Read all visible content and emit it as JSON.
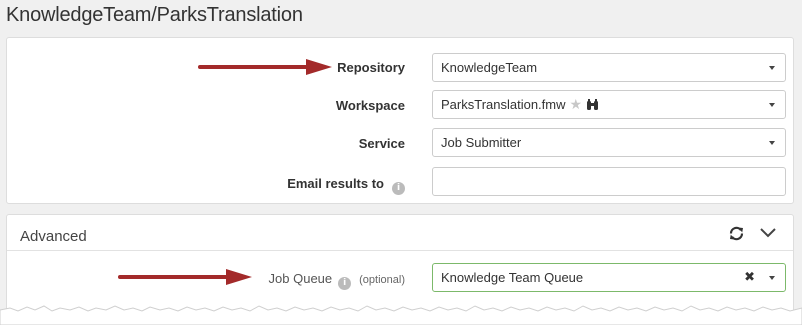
{
  "page": {
    "title": "KnowledgeTeam/ParksTranslation"
  },
  "form": {
    "repository": {
      "label": "Repository",
      "value": "KnowledgeTeam"
    },
    "workspace": {
      "label": "Workspace",
      "value": "ParksTranslation.fmw"
    },
    "service": {
      "label": "Service",
      "value": "Job Submitter"
    },
    "email": {
      "label": "Email results to",
      "value": ""
    }
  },
  "advanced": {
    "title": "Advanced",
    "job_queue": {
      "label": "Job Queue",
      "optional": "(optional)",
      "value": "Knowledge Team Queue"
    }
  },
  "icons": {
    "info": "info-icon",
    "favorite": "star-icon",
    "binoculars": "binoculars-icon",
    "refresh": "refresh-icon",
    "collapse": "chevron-down-icon",
    "clear": "close-icon",
    "dropdown": "caret-down-icon"
  },
  "colors": {
    "annotation_arrow": "#a32a2a",
    "valid_border": "#7cb96a"
  }
}
